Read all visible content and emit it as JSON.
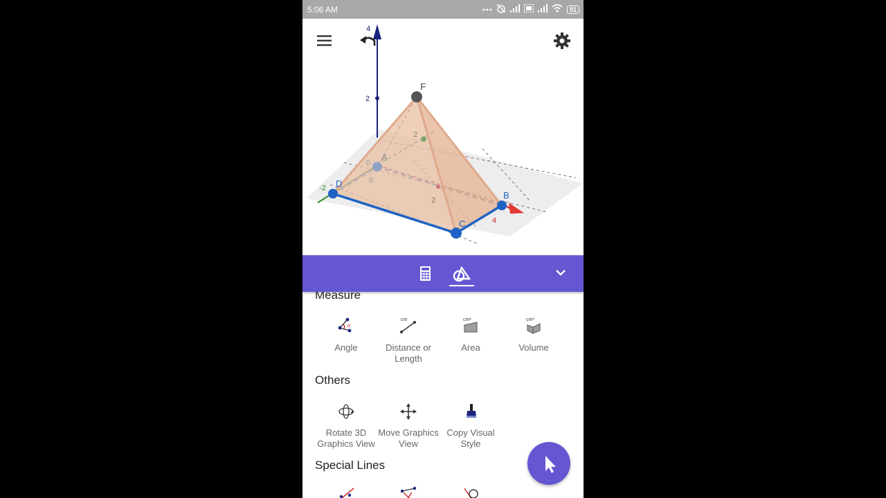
{
  "status_bar": {
    "time": "5:06 AM",
    "battery": "91"
  },
  "graphics": {
    "z_axis_labels": [
      "4",
      "2"
    ],
    "point_labels": {
      "F": "F",
      "A": "A",
      "B": "B",
      "C": "C",
      "D": "D"
    },
    "axis_tick_labels": {
      "grid_2a": "2",
      "grid_2b": "2",
      "origin_0a": "0",
      "origin_0b": "0",
      "x_4": "4",
      "y_neg2": "-2"
    }
  },
  "toolbar": {
    "tabs": [
      "calculator",
      "tools"
    ],
    "active_tab": "tools"
  },
  "sections": [
    {
      "title": "Measure",
      "tools": [
        {
          "label": "Angle",
          "icon": "angle-icon"
        },
        {
          "label": "Distance or Length",
          "icon": "distance-icon"
        },
        {
          "label": "Area",
          "icon": "area-icon"
        },
        {
          "label": "Volume",
          "icon": "volume-icon"
        }
      ]
    },
    {
      "title": "Others",
      "tools": [
        {
          "label": "Rotate 3D Graphics View",
          "icon": "rotate-3d-icon"
        },
        {
          "label": "Move Graphics View",
          "icon": "move-icon"
        },
        {
          "label": "Copy Visual Style",
          "icon": "brush-icon"
        }
      ]
    },
    {
      "title": "Special Lines",
      "tools": []
    }
  ],
  "icon_labels": {
    "area_unit": "cm²",
    "volume_unit": "cm³",
    "distance_unit": "cm",
    "angle_alpha": "α"
  },
  "colors": {
    "accent": "#6557d2",
    "point_blue": "#1565c0",
    "pyramid_fill": "#e7bfa3",
    "pyramid_edge": "#d9a589"
  }
}
